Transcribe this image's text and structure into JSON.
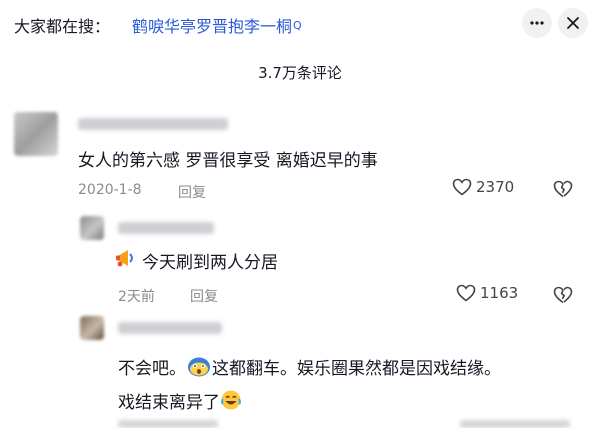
{
  "header": {
    "search_prefix": "大家都在搜：",
    "search_query": "鹤唳华亭罗晋抱李一桐",
    "search_glyph": "Q",
    "more_icon": "more-dots-icon",
    "close_icon": "close-icon"
  },
  "comment_count": "3.7万条评论",
  "comments": [
    {
      "text": "女人的第六感 罗晋很享受 离婚迟早的事",
      "date": "2020-1-8",
      "reply_label": "回复",
      "likes": "2370"
    },
    {
      "text": "今天刷到两人分居",
      "date": "2天前",
      "reply_label": "回复",
      "likes": "1163"
    },
    {
      "line1_a": "不会吧。",
      "line1_b": "这都翻车。娱乐圈果然都是因戏结缘。",
      "line2": "戏结束离异了"
    }
  ],
  "colors": {
    "link": "#2a5bd7",
    "text": "#161823",
    "meta": "#8a8b91"
  }
}
